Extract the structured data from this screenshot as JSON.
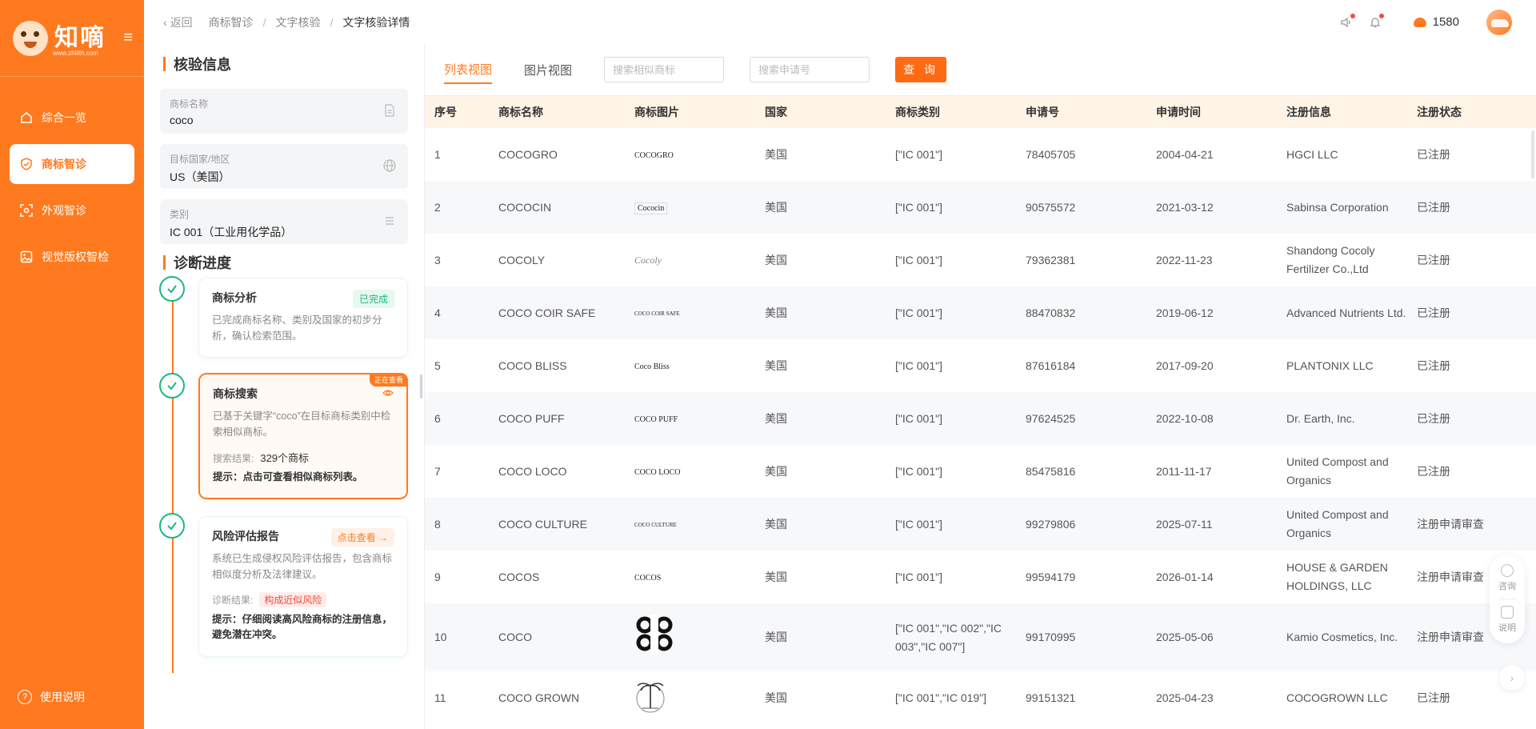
{
  "brand": {
    "name": "知嘀",
    "url": "www.zhiilth.com"
  },
  "sidebar": {
    "items": [
      {
        "label": "综合一览",
        "icon": "home-icon"
      },
      {
        "label": "商标智诊",
        "icon": "shield-check-icon",
        "active": true
      },
      {
        "label": "外观智诊",
        "icon": "scan-icon"
      },
      {
        "label": "视觉版权智检",
        "icon": "image-icon"
      }
    ],
    "help": "使用说明"
  },
  "header": {
    "back": "返回",
    "breadcrumbs": [
      "商标智诊",
      "文字核验",
      "文字核验详情"
    ],
    "points": "1580"
  },
  "verify": {
    "title": "核验信息",
    "fields": [
      {
        "label": "商标名称",
        "value": "coco",
        "icon": "document-icon"
      },
      {
        "label": "目标国家/地区",
        "value": "US（美国）",
        "icon": "globe-icon"
      },
      {
        "label": "类别",
        "value": "IC 001（工业用化学品）",
        "icon": "list-icon"
      }
    ]
  },
  "progress": {
    "title": "诊断进度",
    "steps": [
      {
        "name": "商标分析",
        "badge": "已完成",
        "desc": "已完成商标名称、类别及国家的初步分析，确认检索范围。"
      },
      {
        "name": "商标搜索",
        "badge": "正在查看",
        "desc": "已基于关键字“coco”在目标商标类别中检索相似商标。",
        "result_label": "搜索结果:",
        "result_value": "329个商标",
        "tip": "提示：点击可查看相似商标列表。"
      },
      {
        "name": "风险评估报告",
        "badge": "点击查看 →",
        "desc": "系统已生成侵权风险评估报告，包含商标相似度分析及法律建议。",
        "result_label": "诊断结果:",
        "result_tag": "构成近似风险",
        "tip": "提示：仔细阅读高风险商标的注册信息，避免潜在冲突。"
      }
    ]
  },
  "toolbar": {
    "tabs": [
      "列表视图",
      "图片视图"
    ],
    "search_placeholder": "搜索相似商标",
    "app_placeholder": "搜索申请号",
    "query": "查 询"
  },
  "table": {
    "headers": [
      "序号",
      "商标名称",
      "商标图片",
      "国家",
      "商标类别",
      "申请号",
      "申请时间",
      "注册信息",
      "注册状态"
    ],
    "rows": [
      {
        "no": "1",
        "name": "COCOGRO",
        "logo": "COCOGRO",
        "country": "美国",
        "class": "[\"IC 001\"]",
        "appno": "78405705",
        "date": "2004-04-21",
        "reg": "HGCI LLC",
        "status": "已注册"
      },
      {
        "no": "2",
        "name": "COCOCIN",
        "logo": "Cococin",
        "country": "美国",
        "class": "[\"IC 001\"]",
        "appno": "90575572",
        "date": "2021-03-12",
        "reg": "Sabinsa Corporation",
        "status": "已注册"
      },
      {
        "no": "3",
        "name": "COCOLY",
        "logo": "Cocoly",
        "country": "美国",
        "class": "[\"IC 001\"]",
        "appno": "79362381",
        "date": "2022-11-23",
        "reg": "Shandong Cocoly Fertilizer Co.,Ltd",
        "status": "已注册"
      },
      {
        "no": "4",
        "name": "COCO COIR SAFE",
        "logo": "COCO COIR SAFE",
        "country": "美国",
        "class": "[\"IC 001\"]",
        "appno": "88470832",
        "date": "2019-06-12",
        "reg": "Advanced Nutrients Ltd.",
        "status": "已注册"
      },
      {
        "no": "5",
        "name": "COCO BLISS",
        "logo": "Coco Bliss",
        "country": "美国",
        "class": "[\"IC 001\"]",
        "appno": "87616184",
        "date": "2017-09-20",
        "reg": "PLANTONIX LLC",
        "status": "已注册"
      },
      {
        "no": "6",
        "name": "COCO PUFF",
        "logo": "COCO PUFF",
        "country": "美国",
        "class": "[\"IC 001\"]",
        "appno": "97624525",
        "date": "2022-10-08",
        "reg": "Dr. Earth, Inc.",
        "status": "已注册"
      },
      {
        "no": "7",
        "name": "COCO LOCO",
        "logo": "COCO LOCO",
        "country": "美国",
        "class": "[\"IC 001\"]",
        "appno": "85475816",
        "date": "2011-11-17",
        "reg": "United Compost and Organics",
        "status": "已注册"
      },
      {
        "no": "8",
        "name": "COCO CULTURE",
        "logo": "COCO CULTURE",
        "country": "美国",
        "class": "[\"IC 001\"]",
        "appno": "99279806",
        "date": "2025-07-11",
        "reg": "United Compost and Organics",
        "status": "注册申请审查"
      },
      {
        "no": "9",
        "name": "COCOS",
        "logo": "COCOS",
        "country": "美国",
        "class": "[\"IC 001\"]",
        "appno": "99594179",
        "date": "2026-01-14",
        "reg": "HOUSE & GARDEN HOLDINGS, LLC",
        "status": "注册申请审查"
      },
      {
        "no": "10",
        "name": "COCO",
        "logo": "",
        "country": "美国",
        "class": "[\"IC 001\",\"IC 002\",\"IC 003\",\"IC 007\"]",
        "appno": "99170995",
        "date": "2025-05-06",
        "reg": "Kamio Cosmetics, Inc.",
        "status": "注册申请审查"
      },
      {
        "no": "11",
        "name": "COCO GROWN",
        "logo": "",
        "country": "美国",
        "class": "[\"IC 001\",\"IC 019\"]",
        "appno": "99151321",
        "date": "2025-04-23",
        "reg": "COCOGROWN LLC",
        "status": "已注册"
      }
    ]
  },
  "float": {
    "consult": "咨询",
    "guide": "说明"
  },
  "colors": {
    "accent": "#ff7a1f",
    "success": "#19b97b",
    "danger": "#f04b3c"
  }
}
